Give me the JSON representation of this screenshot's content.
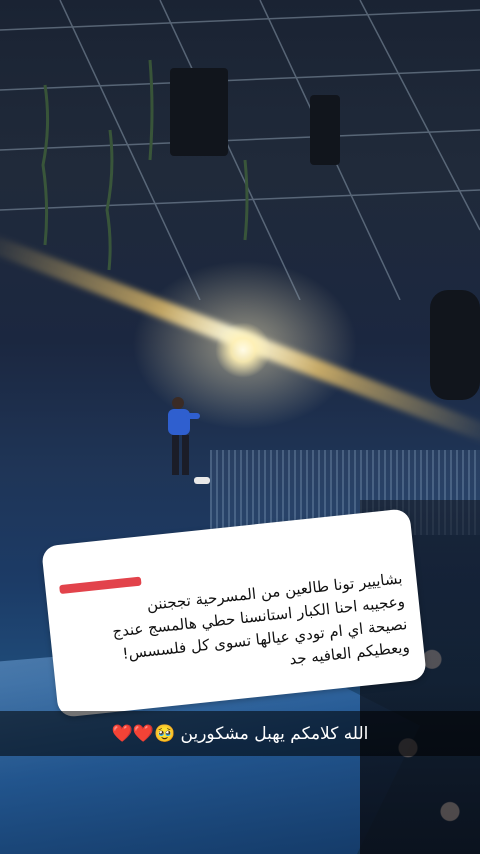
{
  "story": {
    "message_card": {
      "sender_redacted": true,
      "text": "بشاييير تونا طالعين من المسرحية تججننن\nوعجيبه احنا الكبار استانسنا حطي هالمسج عندج\nنصيحة اي ام تودي عيالها تسوى كل فلسسس!\nويعطيكم العافيه جد"
    },
    "caption": {
      "text": "الله كلامكم يهبل مشكورين 🥹❤️❤️"
    },
    "colors": {
      "card_bg": "#ffffff",
      "redaction": "#e2434b",
      "caption_bar": "rgba(0,0,0,0.55)"
    },
    "background_icon": "theater-stage-photo"
  }
}
